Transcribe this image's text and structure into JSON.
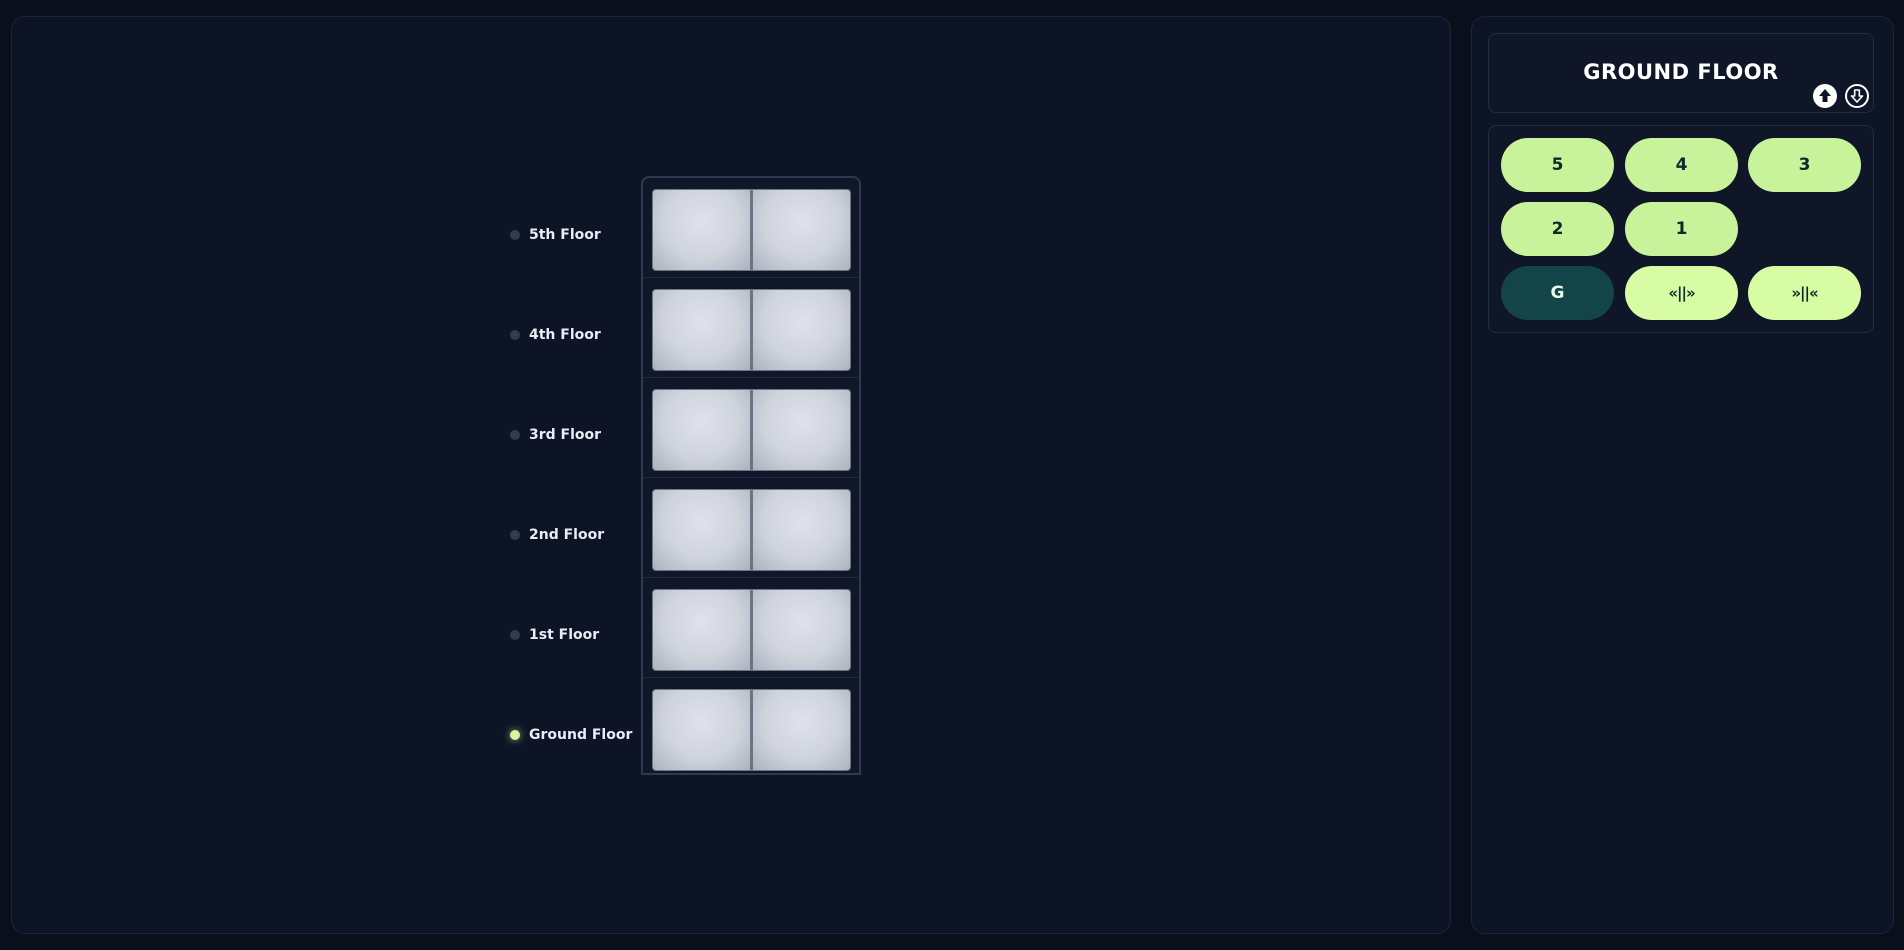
{
  "floors": [
    {
      "label": "5th Floor",
      "active": false
    },
    {
      "label": "4th Floor",
      "active": false
    },
    {
      "label": "3rd Floor",
      "active": false
    },
    {
      "label": "2nd Floor",
      "active": false
    },
    {
      "label": "1st Floor",
      "active": false
    },
    {
      "label": "Ground Floor",
      "active": true
    }
  ],
  "display": {
    "current_floor": "GROUND FLOOR",
    "icons": [
      "arrow-up-circle-icon",
      "arrow-down-circle-icon"
    ]
  },
  "keypad": {
    "keys": [
      "5",
      "4",
      "3",
      "2",
      "1",
      "G"
    ],
    "active_key": "G",
    "open_doors": "«||»",
    "close_doors": "»||«"
  },
  "colors": {
    "background": "#0a0f1c",
    "panel": "#0d1426",
    "key": "#c9f39a",
    "key_active": "#134447",
    "indicator_active": "#d6f7a0"
  }
}
